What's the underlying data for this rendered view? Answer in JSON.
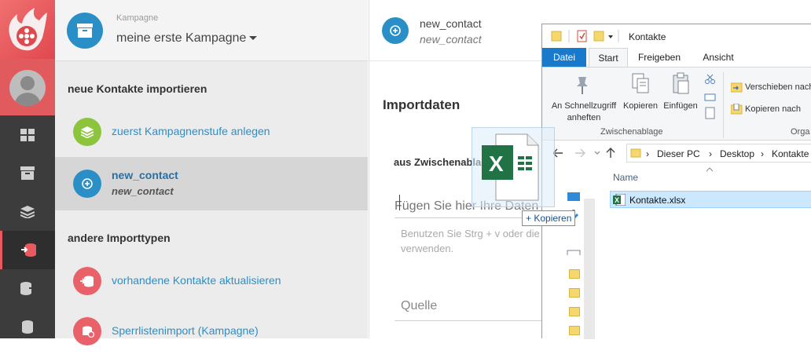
{
  "campaign": {
    "label": "Kampagne",
    "name": "meine erste Kampagne"
  },
  "sidebar": {
    "section_import": "neue Kontakte importieren",
    "item_stage": "zuerst Kampagnenstufe anlegen",
    "item_contact_title": "new_contact",
    "item_contact_sub": "new_contact",
    "section_other": "andere Importtypen",
    "item_update": "vorhandene Kontakte aktualisieren",
    "item_blacklist": "Sperrlistenimport (Kampagne)"
  },
  "main": {
    "title": "new_contact",
    "subtitle": "new_contact",
    "import_heading": "Importdaten",
    "clipboard_label": "aus Zwischenablage",
    "paste_placeholder": "Fügen Sie hier Ihre Daten e",
    "help_text": "Benutzen Sie Strg + v oder die verwenden.",
    "source_label": "Quelle"
  },
  "drag": {
    "copy_tip": "+ Kopieren"
  },
  "explorer": {
    "title": "Kontakte",
    "tabs": [
      "Datei",
      "Start",
      "Freigeben",
      "Ansicht"
    ],
    "ribbon": {
      "pin": "An Schnellzugriff anheften",
      "copy": "Kopieren",
      "paste": "Einfügen",
      "group_clipboard": "Zwischenablage",
      "move": "Verschieben nach",
      "copy_to": "Kopieren nach",
      "group_org": "Orga"
    },
    "breadcrumb": [
      "Dieser PC",
      "Desktop",
      "Kontakte"
    ],
    "column_name": "Name",
    "file": "Kontakte.xlsx"
  },
  "colors": {
    "accent_blue": "#2a8fc7",
    "green": "#8cc43d",
    "red": "#e96169",
    "excel": "#217346"
  }
}
